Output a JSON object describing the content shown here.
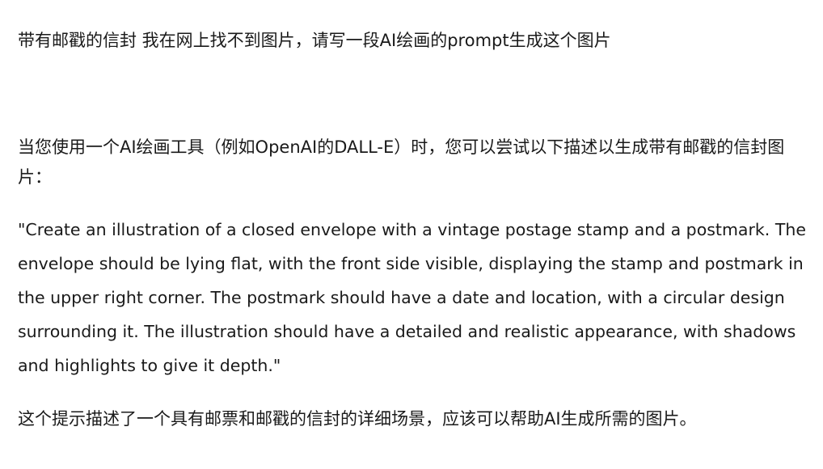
{
  "conversation": {
    "user_message": "带有邮戳的信封 我在网上找不到图片，请写一段AI绘画的prompt生成这个图片",
    "assistant": {
      "intro": "当您使用一个AI绘画工具（例如OpenAI的DALL-E）时，您可以尝试以下描述以生成带有邮戳的信封图片：",
      "prompt": "\"Create an illustration of a closed envelope with a vintage postage stamp and a postmark. The envelope should be lying flat, with the front side visible, displaying the stamp and postmark in the upper right corner. The postmark should have a date and location, with a circular design surrounding it. The illustration should have a detailed and realistic appearance, with shadows and highlights to give it depth.\"",
      "summary": "这个提示描述了一个具有邮票和邮戳的信封的详细场景，应该可以帮助AI生成所需的图片。"
    }
  }
}
